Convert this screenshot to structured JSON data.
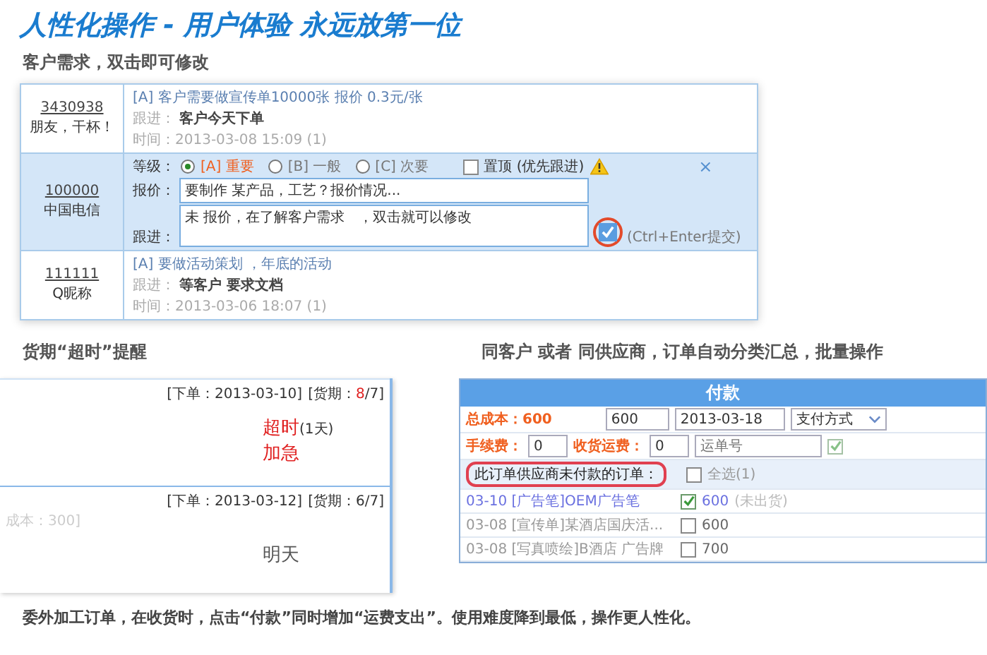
{
  "title": "人性化操作 - 用户体验 永远放第一位",
  "subtitle": "客户需求，双击即可修改",
  "requests": [
    {
      "kind": "plain",
      "id": "3430938",
      "name": "朋友，干杯！",
      "subject": "[A] 客户需要做宣传单10000张 报价 0.3元/张",
      "follow_label": "跟进：",
      "follow": "客户今天下单",
      "time": "时间：2013-03-08 15:09 (1)"
    },
    {
      "kind": "editing",
      "id": "100000",
      "name": "中国电信",
      "grade_label": "等级：",
      "grades": [
        {
          "label": "[A] 重要",
          "selected": true
        },
        {
          "label": "[B] 一般",
          "selected": false
        },
        {
          "label": "[C] 次要",
          "selected": false
        }
      ],
      "pin": {
        "label": "置顶 (优先跟进)",
        "checked": false
      },
      "close": "×",
      "quote_label": "报价：",
      "quote": "要制作 某产品，工艺？报价情况...",
      "follow_label": "跟进：",
      "follow": "未 报价，在了解客户需求　，双击就可以修改",
      "submit": {
        "checked": true,
        "hint": "(Ctrl+Enter提交)"
      }
    },
    {
      "kind": "plain",
      "id": "111111",
      "name": "Q昵称",
      "subject": "[A] 要做活动策划 ，年底的活动",
      "follow_label": "跟进：",
      "follow": "等客户 要求文档",
      "time": "时间：2013-03-06 18:07 (1)"
    }
  ],
  "overdue": {
    "label": "货期“超时”提醒",
    "orders": [
      {
        "order": "[下单：2013-03-10]",
        "due_prefix": "[货期：",
        "due_value": "8",
        "due_suffix": "/7]",
        "overdue": true,
        "status": "超时",
        "status_extra": "(1天)",
        "urgent": "加急"
      },
      {
        "order": "[下单：2013-03-12]",
        "due_prefix": "[货期：",
        "due_value": "6",
        "due_suffix": "/7]",
        "overdue": false,
        "side": "成本：300]",
        "status": "明天"
      }
    ]
  },
  "payment": {
    "label": "同客户 或者 同供应商，订单自动分类汇总，批量操作",
    "title": "付款",
    "total": "总成本：600",
    "amount": "600",
    "date": "2013-03-18",
    "method": "支付方式",
    "fee_label": "手续费：",
    "fee": "0",
    "freight_label": "收货运费：",
    "freight": "0",
    "waybill_placeholder": "运单号",
    "received_checked": true,
    "section": "此订单供应商未付款的订单：",
    "select_all": {
      "label": "全选",
      "count": "(1)",
      "checked": false
    },
    "orders": [
      {
        "date": "03-10",
        "title": "[广告笔]OEM广告笔",
        "amount": "600",
        "note": "(未出货)",
        "checked": true
      },
      {
        "date": "03-08",
        "title": "[宣传单]某酒店国庆活...",
        "amount": "600",
        "checked": false
      },
      {
        "date": "03-08",
        "title": "[写真喷绘]B酒店 广告牌",
        "amount": "700",
        "checked": false
      }
    ]
  },
  "footer": "委外加工订单，在收货时，点击“付款”同时增加“运费支出”。使用难度降到最低，操作更人性化。"
}
